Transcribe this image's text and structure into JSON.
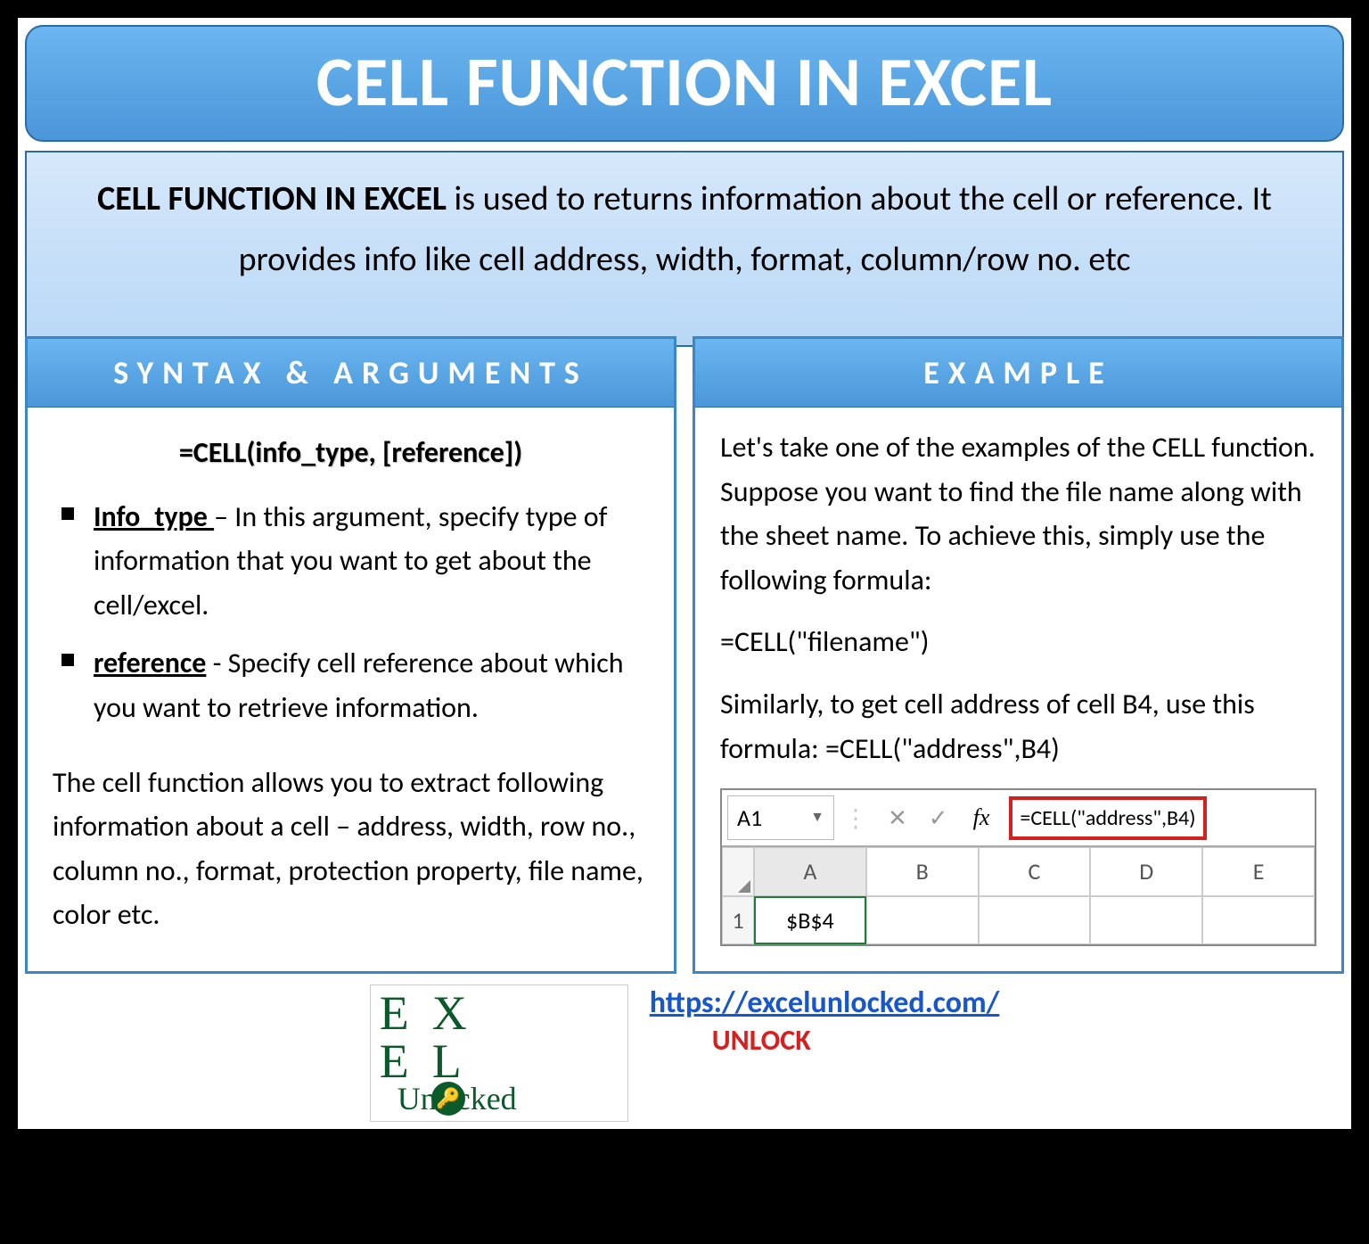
{
  "title": "CELL FUNCTION IN EXCEL",
  "description": {
    "bold": "CELL FUNCTION IN EXCEL",
    "rest": " is used to returns information about the cell or reference. It provides info like cell address, width, format, column/row no. etc"
  },
  "syntax": {
    "heading": "SYNTAX & ARGUMENTS",
    "formula": "=CELL(info_type, [reference])",
    "args": [
      {
        "name": "Info_type ",
        "sep": "– ",
        "text": "In this argument, specify type of information that you want to get about the cell/excel."
      },
      {
        "name": "reference",
        "sep": " - ",
        "text": "Specify cell reference about which you want to retrieve information."
      }
    ],
    "para": "The cell function allows you to extract following information about a cell – address, width, row no., column no., format, protection property, file name, color etc."
  },
  "example": {
    "heading": "EXAMPLE",
    "p1": "Let's take one of the examples of the CELL function. Suppose you want to find the file name along with the sheet name. To achieve this, simply use the following formula:",
    "f1": "=CELL(\"filename\")",
    "p2": "Similarly, to get cell address of cell B4, use this formula: =CELL(\"address\",B4)",
    "shot": {
      "namebox": "A1",
      "fx": "fx",
      "formula": "=CELL(\"address\",B4)",
      "cols": [
        "A",
        "B",
        "C",
        "D",
        "E"
      ],
      "row_label": "1",
      "value": "$B$4"
    }
  },
  "footer": {
    "logo_top": "EX EL",
    "logo_bottom_pre": "Unl",
    "logo_bottom_post": "cked",
    "url": "https://excelunlocked.com/",
    "unlock": "UNLOCK"
  }
}
